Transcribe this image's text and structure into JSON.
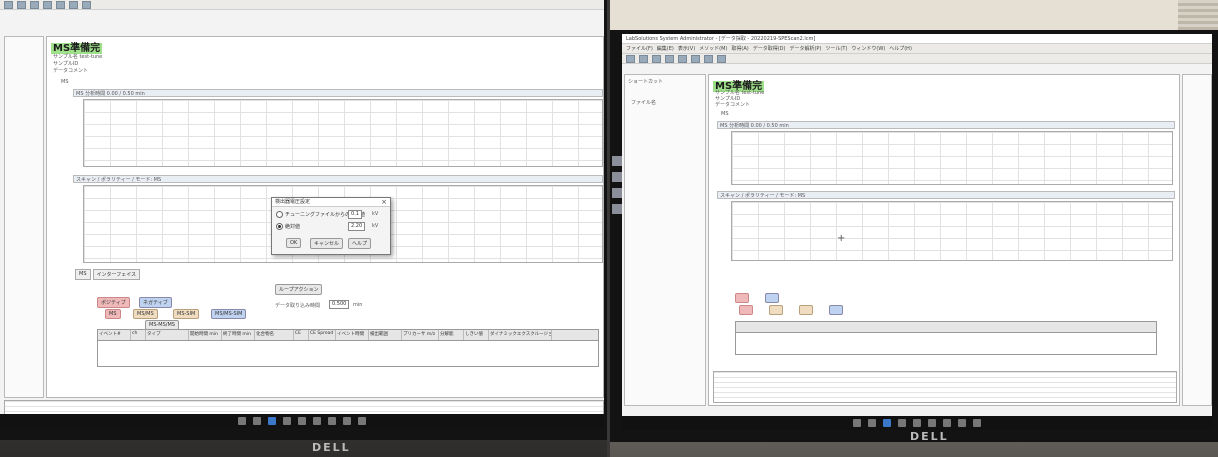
{
  "left": {
    "screen_title": "MS準備完",
    "sample_name_label": "サンプル名",
    "sample_name_value": "test-tune",
    "sample_id_label": "サンプルID",
    "data_comment_label": "データコメント",
    "ms_tab": "MS",
    "tic_header": "MS 分析時間 0.00 / 0.50 min",
    "scan_header": "スキャン / ポラリティー / モード: MS",
    "tabs": [
      "MS",
      "インターフェイス"
    ],
    "polarity_positive": "ポジティブ",
    "polarity_negative": "ネガティブ",
    "tune_button": "ループアクション",
    "interval_label": "データ取り込み時間",
    "interval_value": "0.500",
    "interval_unit": "min",
    "buttons": [
      "MS",
      "MS/MS",
      "MS-SIM",
      "MS/MS-SIM",
      "MS-MS/MS"
    ],
    "table_headers": [
      "イベント#",
      "ch",
      "タイプ",
      "開始時間 min",
      "終了時間 min",
      "化合物名",
      "CE",
      "CE Spread",
      "イベント時間",
      "検出範囲",
      "プリカーサ m/z",
      "分解能",
      "しきい値",
      "ダイナミックエクスクルージョン"
    ],
    "dialog": {
      "title": "検出器電圧設定",
      "option_tuning": "チューニングファイルからの相対値",
      "option_tuning_value": "0.1",
      "option_tuning_unit": "kV",
      "option_absolute": "絶対値",
      "option_absolute_value": "2.20",
      "option_absolute_unit": "kV",
      "ok": "OK",
      "cancel": "キャンセル",
      "help": "ヘルプ"
    }
  },
  "right": {
    "window_title": "LabSolutions System Administrator - [データ採取 - 20220219-SPEScan2.lcm]",
    "menu": [
      "ファイル(F)",
      "編集(E)",
      "表示(V)",
      "メソッド(M)",
      "取得(A)",
      "データ取得(D)",
      "データ解析(P)",
      "ツール(T)",
      "ウィンドウ(W)",
      "ヘルプ(H)"
    ],
    "screen_title": "MS準備完",
    "sample_name_label": "サンプル名",
    "sample_name_value": "test-tune",
    "sample_id_label": "サンプルID",
    "data_comment_label": "データコメント",
    "sidebar_header": "ショートカット",
    "sidebar_item": "ファイル名",
    "ms_tab": "MS",
    "tic_header": "MS 分析時間 0.00 / 0.50 min",
    "scan_header": "スキャン / ポラリティー / モード: MS"
  },
  "colors": {
    "ready_highlight": "#9fe08a",
    "screen_bg": "#f3f3f3",
    "bezel": "#131313"
  },
  "brand": "DELL"
}
